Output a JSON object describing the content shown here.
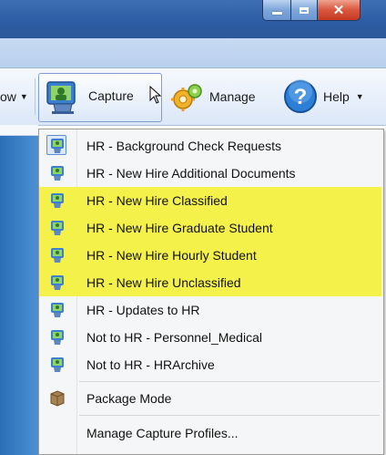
{
  "toolbar": {
    "prev_label": "ow",
    "capture_label": "Capture",
    "manage_label": "Manage",
    "help_label": "Help"
  },
  "menu": {
    "items": [
      {
        "label": "HR - Background Check Requests",
        "icon": "capture-profile-icon"
      },
      {
        "label": "HR - New Hire Additional Documents",
        "icon": "capture-profile-icon"
      },
      {
        "label": "HR - New Hire Classified",
        "icon": "capture-profile-icon"
      },
      {
        "label": "HR - New Hire Graduate Student",
        "icon": "capture-profile-icon"
      },
      {
        "label": "HR - New Hire Hourly Student",
        "icon": "capture-profile-icon"
      },
      {
        "label": "HR - New Hire Unclassified",
        "icon": "capture-profile-icon"
      },
      {
        "label": "HR - Updates to HR",
        "icon": "capture-profile-icon"
      },
      {
        "label": "Not to HR - Personnel_Medical",
        "icon": "capture-profile-icon"
      },
      {
        "label": "Not to HR - HRArchive",
        "icon": "capture-profile-icon"
      },
      {
        "label": "Package Mode",
        "icon": "package-icon"
      },
      {
        "label": "Manage Capture Profiles...",
        "icon": ""
      }
    ]
  },
  "colors": {
    "highlight": "#f4f14a",
    "titlebar": "#2e5ea6",
    "close_button": "#d9563c"
  }
}
